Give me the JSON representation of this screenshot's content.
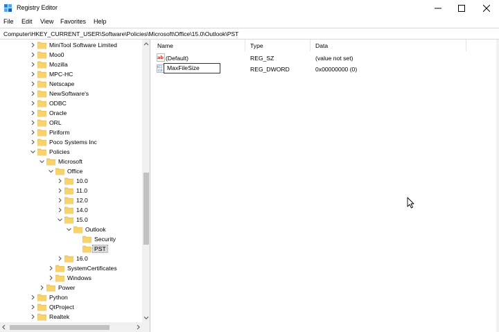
{
  "window": {
    "title": "Registry Editor"
  },
  "menu": [
    "File",
    "Edit",
    "View",
    "Favorites",
    "Help"
  ],
  "address": "Computer\\HKEY_CURRENT_USER\\Software\\Policies\\Microsoft\\Office\\15.0\\Outlook\\PST",
  "tree": [
    {
      "label": "MiniTool Software Limited",
      "level": 3,
      "state": "collapsed"
    },
    {
      "label": "Moo0",
      "level": 3,
      "state": "collapsed"
    },
    {
      "label": "Mozilla",
      "level": 3,
      "state": "collapsed"
    },
    {
      "label": "MPC-HC",
      "level": 3,
      "state": "collapsed"
    },
    {
      "label": "Netscape",
      "level": 3,
      "state": "collapsed"
    },
    {
      "label": "NewSoftware's",
      "level": 3,
      "state": "collapsed"
    },
    {
      "label": "ODBC",
      "level": 3,
      "state": "collapsed"
    },
    {
      "label": "Oracle",
      "level": 3,
      "state": "collapsed"
    },
    {
      "label": "ORL",
      "level": 3,
      "state": "collapsed"
    },
    {
      "label": "Piriform",
      "level": 3,
      "state": "collapsed"
    },
    {
      "label": "Poco Systems Inc",
      "level": 3,
      "state": "collapsed"
    },
    {
      "label": "Policies",
      "level": 3,
      "state": "expanded"
    },
    {
      "label": "Microsoft",
      "level": 4,
      "state": "expanded"
    },
    {
      "label": "Office",
      "level": 5,
      "state": "expanded"
    },
    {
      "label": "10.0",
      "level": 6,
      "state": "collapsed"
    },
    {
      "label": "11.0",
      "level": 6,
      "state": "collapsed"
    },
    {
      "label": "12.0",
      "level": 6,
      "state": "collapsed"
    },
    {
      "label": "14.0",
      "level": 6,
      "state": "collapsed"
    },
    {
      "label": "15.0",
      "level": 6,
      "state": "expanded"
    },
    {
      "label": "Outlook",
      "level": 7,
      "state": "expanded"
    },
    {
      "label": "Security",
      "level": 8,
      "state": "leaf"
    },
    {
      "label": "PST",
      "level": 8,
      "state": "leaf",
      "selected": true
    },
    {
      "label": "16.0",
      "level": 6,
      "state": "collapsed"
    },
    {
      "label": "SystemCertificates",
      "level": 5,
      "state": "collapsed"
    },
    {
      "label": "Windows",
      "level": 5,
      "state": "collapsed"
    },
    {
      "label": "Power",
      "level": 4,
      "state": "collapsed"
    },
    {
      "label": "Python",
      "level": 3,
      "state": "collapsed"
    },
    {
      "label": "QtProject",
      "level": 3,
      "state": "collapsed"
    },
    {
      "label": "Realtek",
      "level": 3,
      "state": "collapsed"
    }
  ],
  "columns": {
    "name": "Name",
    "type": "Type",
    "data": "Data"
  },
  "values": [
    {
      "name": "(Default)",
      "type": "REG_SZ",
      "data": "(value not set)",
      "icon": "string-value-icon"
    },
    {
      "name": "MaxFileSize",
      "type": "REG_DWORD",
      "data": "0x00000000 (0)",
      "icon": "binary-value-icon",
      "editing": true
    }
  ],
  "colors": {
    "folder": "#f6d36b",
    "folder_dark": "#e0b44c",
    "selection": "#d9d9d9",
    "scroll_thumb": "#c1c1c1"
  }
}
